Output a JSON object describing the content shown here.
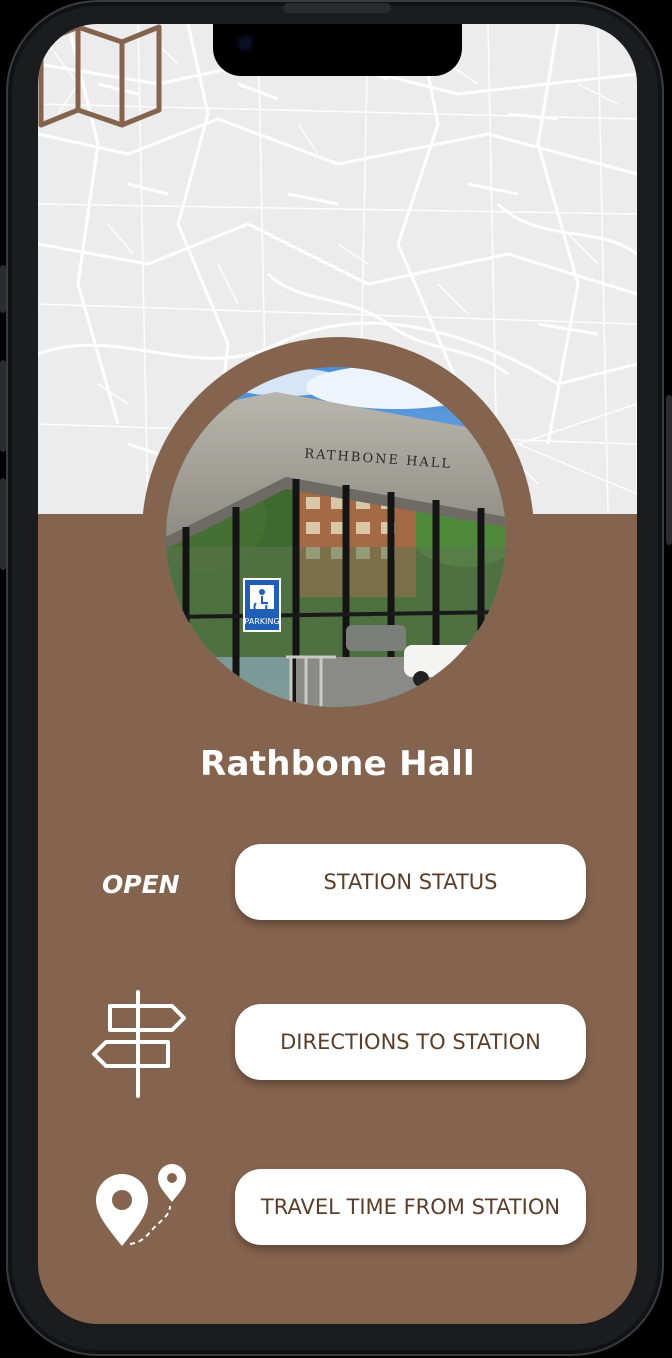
{
  "station": {
    "name": "Rathbone Hall",
    "status": "OPEN"
  },
  "photo": {
    "building_sign": "RATHBONE HALL",
    "parking_sign": "PARKING"
  },
  "actions": {
    "status_label": "STATION STATUS",
    "directions_label": "DIRECTIONS TO STATION",
    "travel_label": "TRAVEL TIME FROM STATION"
  },
  "icons": {
    "header": "folded-map-icon",
    "directions": "signpost-icon",
    "travel": "route-pins-icon"
  },
  "colors": {
    "brand_brown": "#85644f",
    "map_background": "#ececec",
    "button_text": "#5b3e2a",
    "button_background": "#ffffff"
  }
}
